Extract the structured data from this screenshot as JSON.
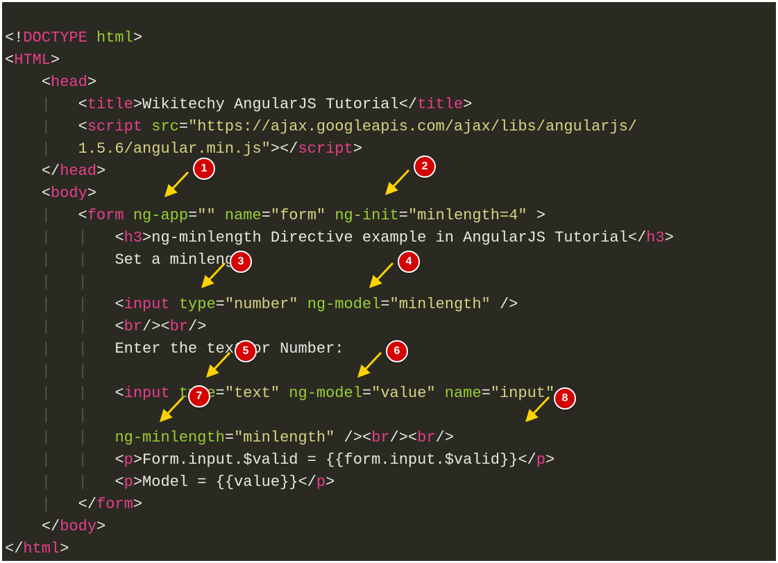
{
  "code": {
    "l01": {
      "a": "<!",
      "b": "DOCTYPE",
      "c": " ",
      "d": "html",
      "e": ">"
    },
    "l02": {
      "a": "<",
      "b": "HTML",
      "c": ">"
    },
    "l03": {
      "p": "    ",
      "a": "<",
      "b": "head",
      "c": ">"
    },
    "l04": {
      "p": "    |   ",
      "a": "<",
      "b": "title",
      "c": ">",
      "t": "Wikitechy AngularJS Tutorial",
      "d": "</",
      "e": "title",
      "f": ">"
    },
    "l05": {
      "p": "    |   ",
      "a": "<",
      "b": "script",
      "c": " ",
      "d": "src",
      "e": "=",
      "f": "\"https://ajax.googleapis.com/ajax/libs/angularjs/"
    },
    "l06": {
      "p": "    |   ",
      "f": "1.5.6/angular.min.js\"",
      "a": "></",
      "b": "script",
      "c": ">"
    },
    "l07": {
      "p": "    ",
      "a": "</",
      "b": "head",
      "c": ">"
    },
    "l08": {
      "p": "    ",
      "a": "<",
      "b": "body",
      "c": ">"
    },
    "l09": {
      "p": "    |   ",
      "a": "<",
      "b": "form",
      "c": " ",
      "d": "ng-app",
      "e": "=",
      "f": "\"\"",
      "g": " ",
      "h": "name",
      "i": "=",
      "j": "\"form\"",
      "k": " ",
      "l": "ng-init",
      "m": "=",
      "n": "\"minlength=4\"",
      "o": " >"
    },
    "l10": {
      "p": "    |   |   ",
      "a": "<",
      "b": "h3",
      "c": ">",
      "t": "ng-minlength Directive example in AngularJS Tutorial",
      "d": "</",
      "e": "h3",
      "f": ">"
    },
    "l11": {
      "p": "    |   |   ",
      "t": "Set a minlength"
    },
    "l12": {
      "p": "    |   |   "
    },
    "l13": {
      "p": "    |   |   ",
      "a": "<",
      "b": "input",
      "c": " ",
      "d": "type",
      "e": "=",
      "f": "\"number\"",
      "g": " ",
      "h": "ng-model",
      "i": "=",
      "j": "\"minlength\"",
      "k": " />"
    },
    "l14": {
      "p": "    |   |   ",
      "a": "<",
      "b": "br",
      "c": "/><",
      "d": "br",
      "e": "/>"
    },
    "l15": {
      "p": "    |   |   ",
      "t": "Enter the text or Number:"
    },
    "l16": {
      "p": "    |   |   "
    },
    "l17": {
      "p": "    |   |   ",
      "a": "<",
      "b": "input",
      "c": " ",
      "d": "type",
      "e": "=",
      "f": "\"text\"",
      "g": " ",
      "h": "ng-model",
      "i": "=",
      "j": "\"value\"",
      "k": " ",
      "l": "name",
      "m": "=",
      "n": "\"input\""
    },
    "l18": {
      "p": "    |   |   "
    },
    "l19": {
      "p": "    |   |   ",
      "d": "ng-minlength",
      "e": "=",
      "f": "\"minlength\"",
      "k": " /><",
      "b1": "br",
      "c1": "/><",
      "b2": "br",
      "c2": "/>"
    },
    "l20": {
      "p": "    |   |   ",
      "a": "<",
      "b": "p",
      "c": ">",
      "t": "Form.input.$valid = {{form.input.$valid}}",
      "d": "</",
      "e": "p",
      "f": ">"
    },
    "l21": {
      "p": "    |   |   ",
      "a": "<",
      "b": "p",
      "c": ">",
      "t": "Model = {{value}}",
      "d": "</",
      "e": "p",
      "f": ">"
    },
    "l22": {
      "p": "    |   ",
      "a": "</",
      "b": "form",
      "c": ">"
    },
    "l23": {
      "p": "    ",
      "a": "</",
      "b": "body",
      "c": ">"
    },
    "l24": {
      "a": "</",
      "b": "html",
      "c": ">"
    }
  },
  "callouts": [
    {
      "n": "1"
    },
    {
      "n": "2"
    },
    {
      "n": "3"
    },
    {
      "n": "4"
    },
    {
      "n": "5"
    },
    {
      "n": "6"
    },
    {
      "n": "7"
    },
    {
      "n": "8"
    }
  ]
}
